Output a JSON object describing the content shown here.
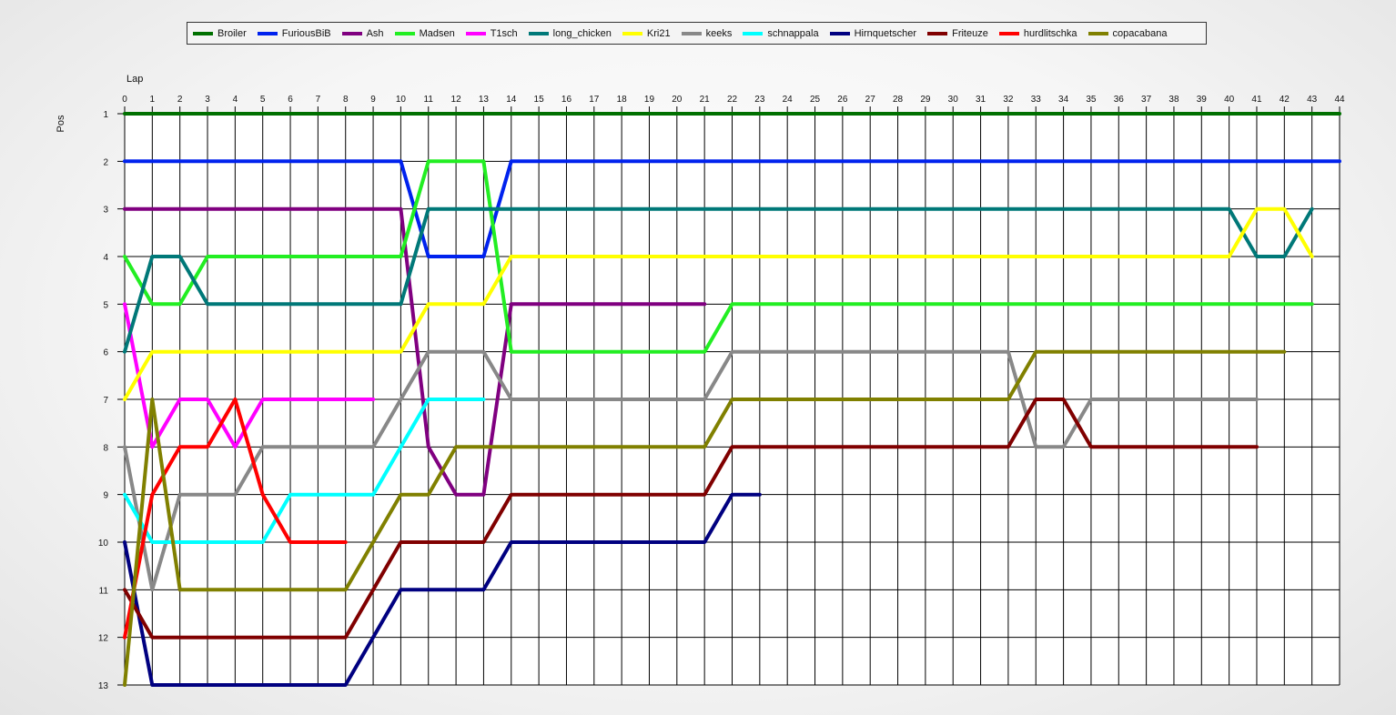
{
  "chart_data": {
    "type": "line",
    "xlabel": "Lap",
    "ylabel": "Pos",
    "x_ticks": [
      0,
      1,
      2,
      3,
      4,
      5,
      6,
      7,
      8,
      9,
      10,
      11,
      12,
      13,
      14,
      15,
      16,
      17,
      18,
      19,
      20,
      21,
      22,
      23,
      24,
      25,
      26,
      27,
      28,
      29,
      30,
      31,
      32,
      33,
      34,
      35,
      36,
      37,
      38,
      39,
      40,
      41,
      42,
      43,
      44
    ],
    "y_ticks": [
      1,
      2,
      3,
      4,
      5,
      6,
      7,
      8,
      9,
      10,
      11,
      12,
      13
    ],
    "xlim": [
      0,
      44
    ],
    "ylim": [
      1,
      13
    ],
    "y_inverted": true,
    "grid": true,
    "legend_position": "top",
    "series": [
      {
        "name": "Broiler",
        "color": "#007000",
        "points": [
          [
            0,
            1
          ],
          [
            44,
            1
          ]
        ]
      },
      {
        "name": "FuriousBiB",
        "color": "#0022ee",
        "points": [
          [
            0,
            2
          ],
          [
            10,
            2
          ],
          [
            11,
            4
          ],
          [
            13,
            4
          ],
          [
            14,
            2
          ],
          [
            44,
            2
          ]
        ]
      },
      {
        "name": "Ash",
        "color": "#800080",
        "points": [
          [
            0,
            3
          ],
          [
            10,
            3
          ],
          [
            11,
            8
          ],
          [
            12,
            9
          ],
          [
            13,
            9
          ],
          [
            14,
            5
          ],
          [
            21,
            5
          ]
        ]
      },
      {
        "name": "Madsen",
        "color": "#22ee22",
        "points": [
          [
            0,
            4
          ],
          [
            1,
            5
          ],
          [
            2,
            5
          ],
          [
            3,
            4
          ],
          [
            10,
            4
          ],
          [
            11,
            2
          ],
          [
            13,
            2
          ],
          [
            14,
            6
          ],
          [
            21,
            6
          ],
          [
            22,
            5
          ],
          [
            43,
            5
          ]
        ]
      },
      {
        "name": "T1sch",
        "color": "#ff00ff",
        "points": [
          [
            0,
            5
          ],
          [
            1,
            8
          ],
          [
            2,
            7
          ],
          [
            3,
            7
          ],
          [
            4,
            8
          ],
          [
            5,
            7
          ],
          [
            9,
            7
          ]
        ]
      },
      {
        "name": "long_chicken",
        "color": "#007878",
        "points": [
          [
            0,
            6
          ],
          [
            1,
            4
          ],
          [
            2,
            4
          ],
          [
            3,
            5
          ],
          [
            10,
            5
          ],
          [
            11,
            3
          ],
          [
            40,
            3
          ],
          [
            41,
            4
          ],
          [
            42,
            4
          ],
          [
            43,
            3
          ]
        ]
      },
      {
        "name": "Kri21",
        "color": "#ffff00",
        "points": [
          [
            0,
            7
          ],
          [
            1,
            6
          ],
          [
            10,
            6
          ],
          [
            11,
            5
          ],
          [
            13,
            5
          ],
          [
            14,
            4
          ],
          [
            40,
            4
          ],
          [
            41,
            3
          ],
          [
            42,
            3
          ],
          [
            43,
            4
          ]
        ]
      },
      {
        "name": "keeks",
        "color": "#888888",
        "points": [
          [
            0,
            8
          ],
          [
            1,
            11
          ],
          [
            2,
            9
          ],
          [
            4,
            9
          ],
          [
            5,
            8
          ],
          [
            9,
            8
          ],
          [
            11,
            6
          ],
          [
            13,
            6
          ],
          [
            14,
            7
          ],
          [
            21,
            7
          ],
          [
            22,
            6
          ],
          [
            32,
            6
          ],
          [
            33,
            8
          ],
          [
            34,
            8
          ],
          [
            35,
            7
          ],
          [
            41,
            7
          ]
        ]
      },
      {
        "name": "schnappala",
        "color": "#00ffff",
        "points": [
          [
            0,
            9
          ],
          [
            1,
            10
          ],
          [
            5,
            10
          ],
          [
            6,
            9
          ],
          [
            9,
            9
          ],
          [
            11,
            7
          ],
          [
            13,
            7
          ]
        ]
      },
      {
        "name": "Hirnquetscher",
        "color": "#000080",
        "points": [
          [
            0,
            10
          ],
          [
            1,
            13
          ],
          [
            8,
            13
          ],
          [
            10,
            11
          ],
          [
            13,
            11
          ],
          [
            14,
            10
          ],
          [
            21,
            10
          ],
          [
            22,
            9
          ],
          [
            23,
            9
          ]
        ]
      },
      {
        "name": "Friteuze",
        "color": "#800000",
        "points": [
          [
            0,
            11
          ],
          [
            1,
            12
          ],
          [
            8,
            12
          ],
          [
            10,
            10
          ],
          [
            13,
            10
          ],
          [
            14,
            9
          ],
          [
            21,
            9
          ],
          [
            22,
            8
          ],
          [
            32,
            8
          ],
          [
            33,
            7
          ],
          [
            34,
            7
          ],
          [
            35,
            8
          ],
          [
            41,
            8
          ]
        ]
      },
      {
        "name": "hurdlitschka",
        "color": "#ff0000",
        "points": [
          [
            0,
            12
          ],
          [
            1,
            9
          ],
          [
            2,
            8
          ],
          [
            3,
            8
          ],
          [
            4,
            7
          ],
          [
            5,
            9
          ],
          [
            6,
            10
          ],
          [
            8,
            10
          ]
        ]
      },
      {
        "name": "copacabana",
        "color": "#808000",
        "points": [
          [
            0,
            13
          ],
          [
            1,
            7
          ],
          [
            2,
            11
          ],
          [
            8,
            11
          ],
          [
            10,
            9
          ],
          [
            11,
            9
          ],
          [
            12,
            8
          ],
          [
            21,
            8
          ],
          [
            22,
            7
          ],
          [
            32,
            7
          ],
          [
            33,
            6
          ],
          [
            42,
            6
          ]
        ]
      }
    ]
  }
}
